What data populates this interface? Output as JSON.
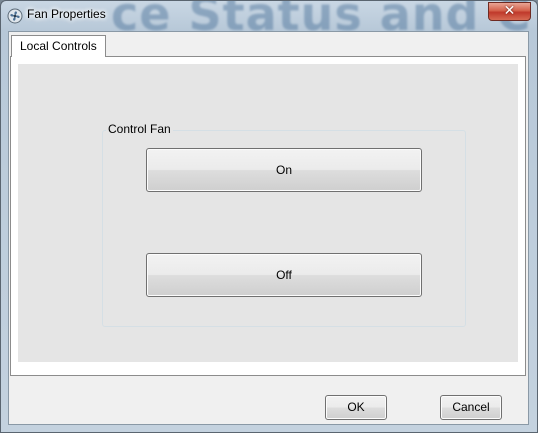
{
  "window": {
    "title": "Fan Properties",
    "background_text": "ce Status and C",
    "close_symbol": "✕",
    "icon": "fan-icon"
  },
  "tabs": [
    {
      "label": "Local Controls",
      "selected": true
    }
  ],
  "control_fan": {
    "group_label": "Control Fan",
    "on_label": "On",
    "off_label": "Off"
  },
  "footer": {
    "ok_label": "OK",
    "cancel_label": "Cancel"
  }
}
